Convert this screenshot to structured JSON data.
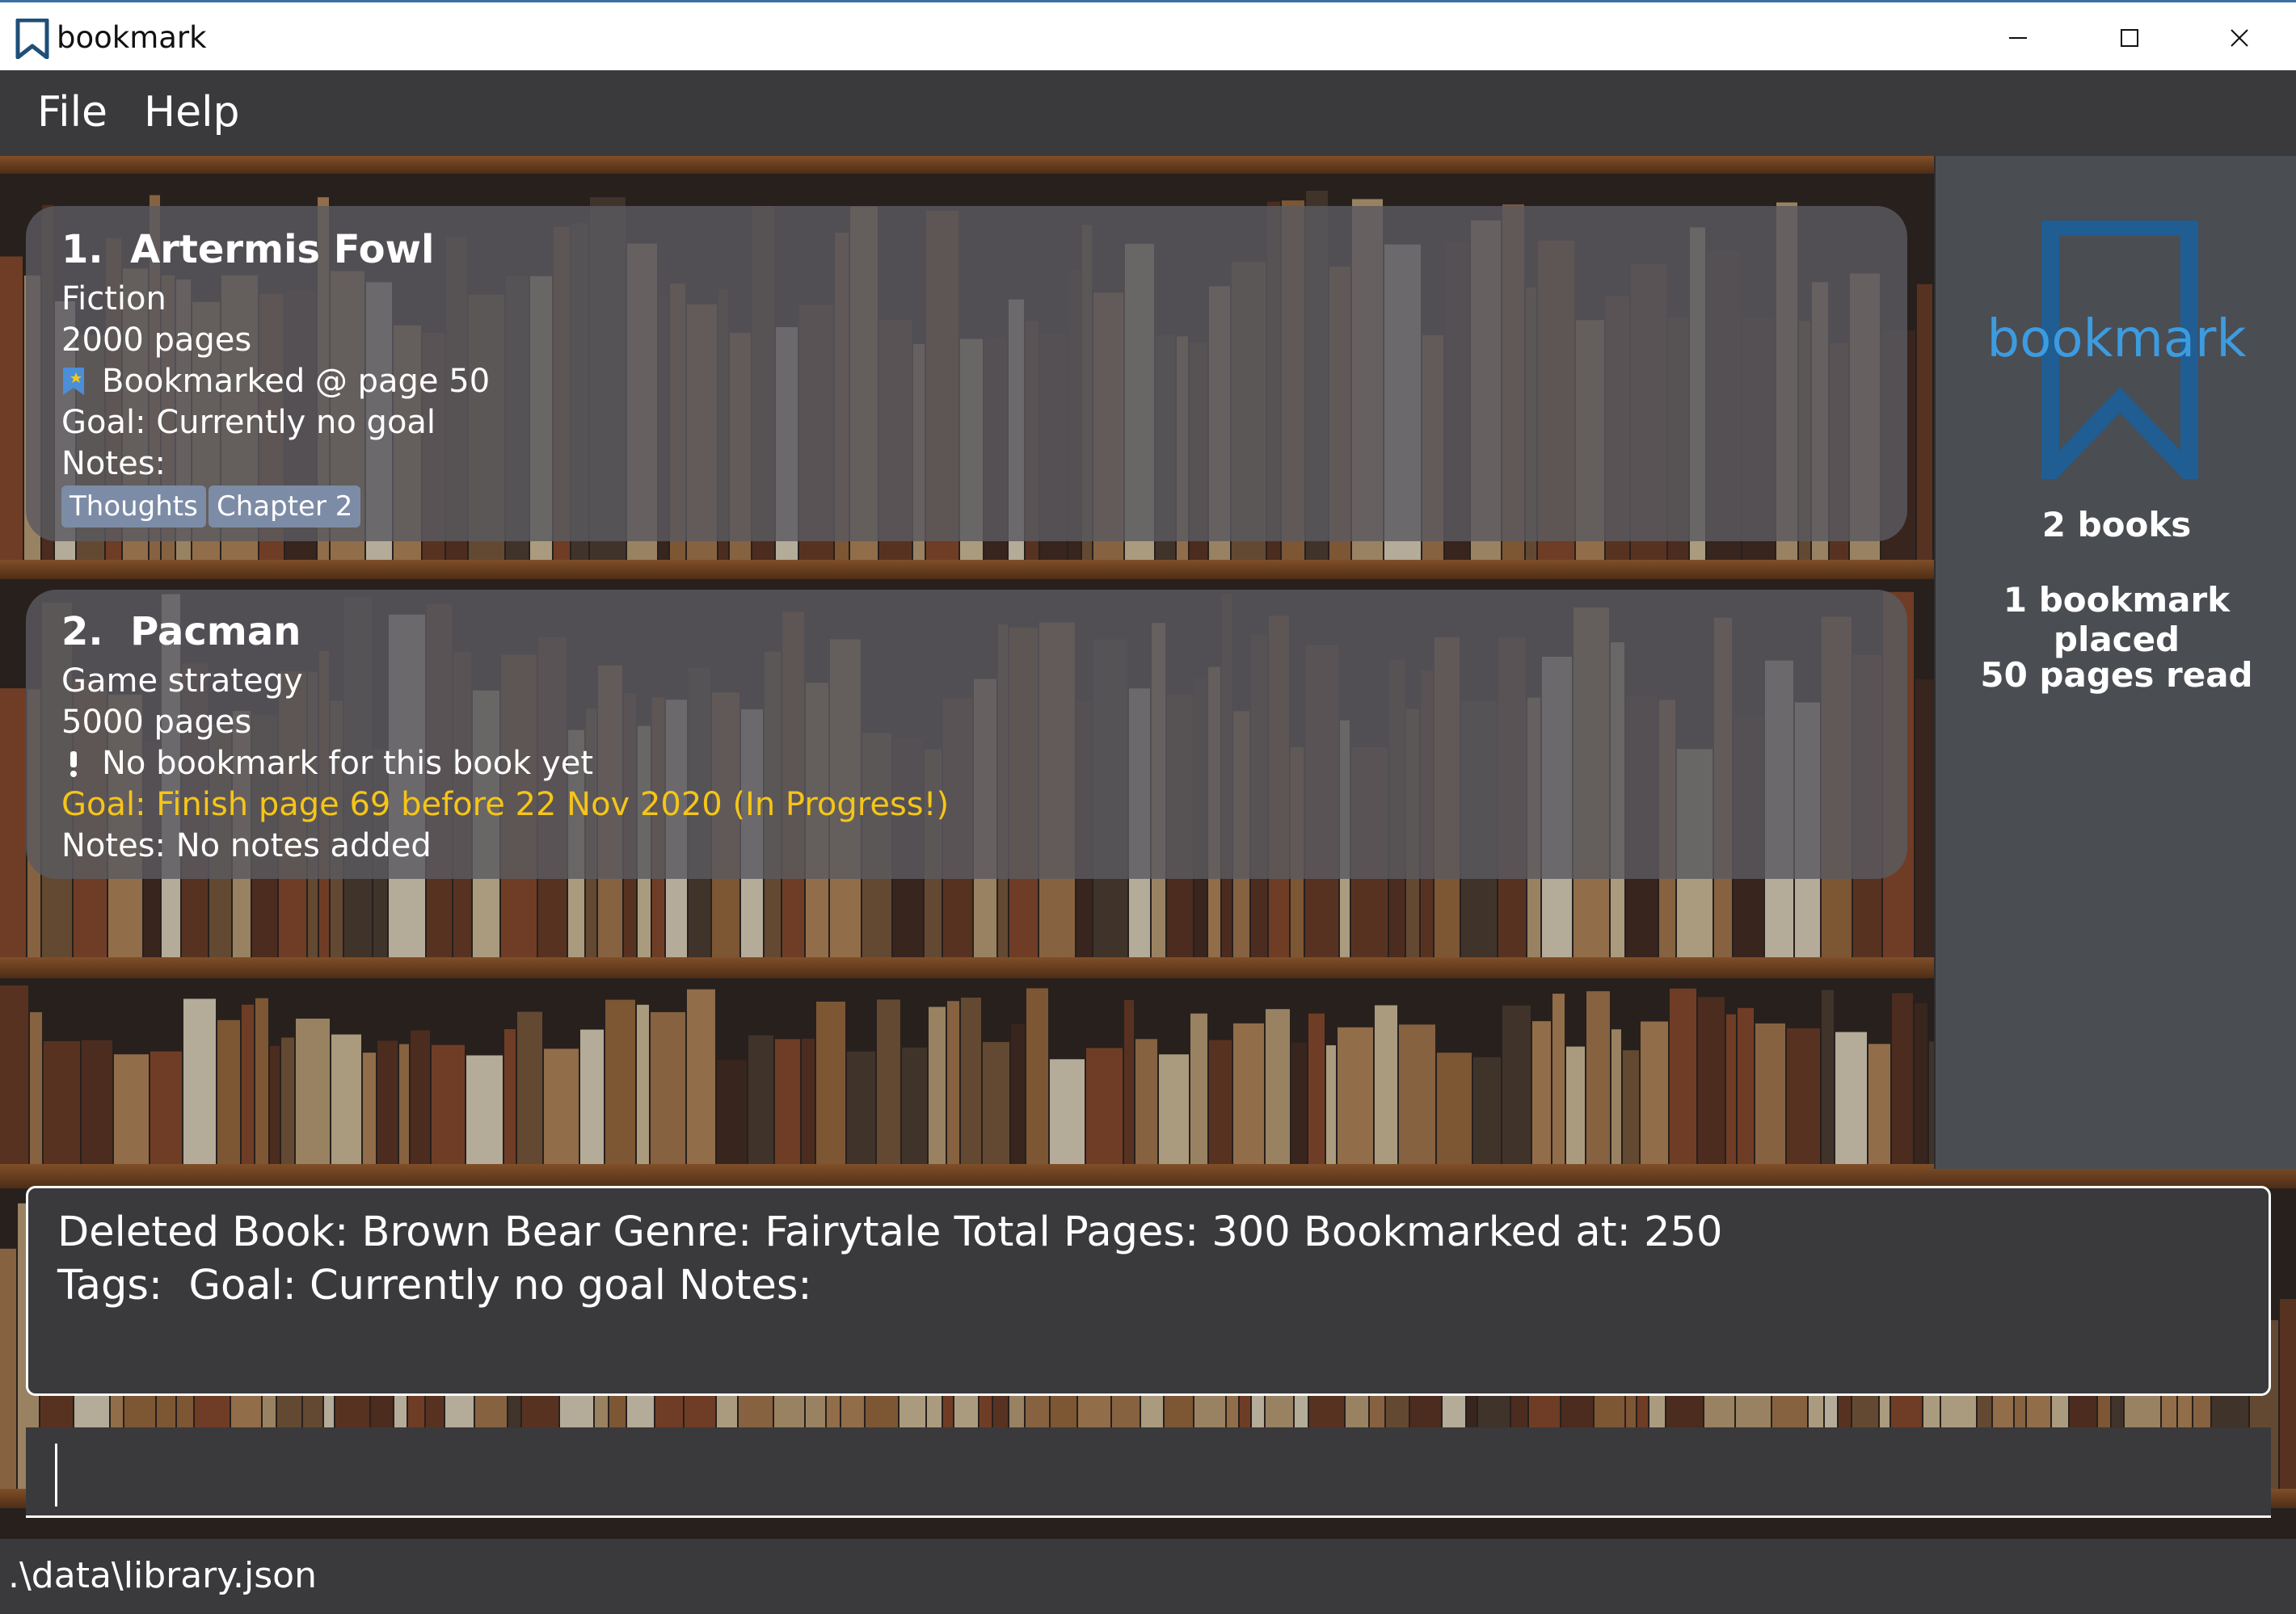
{
  "window": {
    "title": "bookmark",
    "icon": "bookmark-icon",
    "controls": [
      "minimize-icon",
      "maximize-icon",
      "close-icon"
    ]
  },
  "menu": {
    "file": "File",
    "help": "Help"
  },
  "books": [
    {
      "index": "1.",
      "title": "Artermis Fowl",
      "genre": "Fiction",
      "pages": "2000 pages",
      "bookmark": "Bookmarked @ page 50",
      "bookmark_icon": "bookmark-star-icon",
      "goal": "Goal: Currently no goal",
      "notes_label": "Notes:",
      "tags": [
        "Thoughts",
        "Chapter 2"
      ]
    },
    {
      "index": "2.",
      "title": "Pacman",
      "genre": "Game strategy",
      "pages": "5000 pages",
      "bookmark": "No bookmark for this book yet",
      "bookmark_icon": "exclamation-icon",
      "goal": "Goal: Finish page 69 before 22 Nov 2020 (In Progress!)",
      "notes_label": "Notes: No notes added",
      "tags": []
    }
  ],
  "stats": {
    "logo_text": "bookmark",
    "books": "2 books",
    "bookmarks": "1 bookmark placed",
    "pages_read": "50 pages read"
  },
  "result": {
    "line1": "Deleted Book: Brown Bear Genre: Fairytale Total Pages: 300 Bookmarked at: 250",
    "line2": "Tags:  Goal: Currently no goal Notes:"
  },
  "command": {
    "value": ""
  },
  "status": {
    "path": ".\\data\\library.json"
  },
  "colors": {
    "accent": "#3d9be0",
    "goal_in_progress": "#f5c518",
    "tag_bg": "#7d8ca6",
    "panel_bg": "#4a4d52",
    "app_bg": "#3a3a3c"
  }
}
